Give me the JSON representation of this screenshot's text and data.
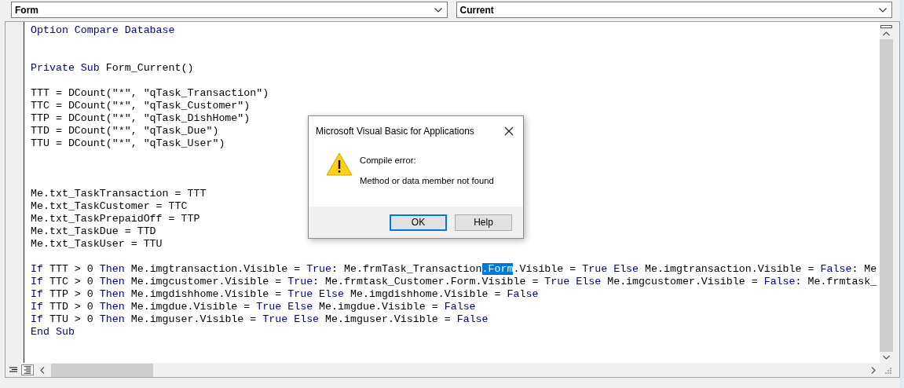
{
  "object_box": {
    "value": "Form"
  },
  "procedure_box": {
    "value": "Current"
  },
  "code_lines": [
    {
      "kind": "code",
      "tokens": [
        {
          "t": "Option Compare Database",
          "kw": true
        }
      ]
    },
    {
      "kind": "blank"
    },
    {
      "kind": "blank"
    },
    {
      "kind": "code",
      "tokens": [
        {
          "t": "Private Sub",
          "kw": true
        },
        {
          "t": " Form_Current()",
          "kw": false
        }
      ]
    },
    {
      "kind": "blank"
    },
    {
      "kind": "code",
      "tokens": [
        {
          "t": "TTT = DCount(\"*\", \"qTask_Transaction\")",
          "kw": false
        }
      ]
    },
    {
      "kind": "code",
      "tokens": [
        {
          "t": "TTC = DCount(\"*\", \"qTask_Customer\")",
          "kw": false
        }
      ]
    },
    {
      "kind": "code",
      "tokens": [
        {
          "t": "TTP = DCount(\"*\", \"qTask_DishHome\")",
          "kw": false
        }
      ]
    },
    {
      "kind": "code",
      "tokens": [
        {
          "t": "TTD = DCount(\"*\", \"qTask_Due\")",
          "kw": false
        }
      ]
    },
    {
      "kind": "code",
      "tokens": [
        {
          "t": "TTU = DCount(\"*\", \"qTask_User\")",
          "kw": false
        }
      ]
    },
    {
      "kind": "blank"
    },
    {
      "kind": "blank"
    },
    {
      "kind": "blank"
    },
    {
      "kind": "code",
      "tokens": [
        {
          "t": "Me.txt_TaskTransaction = TTT",
          "kw": false
        }
      ]
    },
    {
      "kind": "code",
      "tokens": [
        {
          "t": "Me.txt_TaskCustomer = TTC",
          "kw": false
        }
      ]
    },
    {
      "kind": "code",
      "tokens": [
        {
          "t": "Me.txt_TaskPrepaidOff = TTP",
          "kw": false
        }
      ]
    },
    {
      "kind": "code",
      "tokens": [
        {
          "t": "Me.txt_TaskDue = TTD",
          "kw": false
        }
      ]
    },
    {
      "kind": "code",
      "tokens": [
        {
          "t": "Me.txt_TaskUser = TTU",
          "kw": false
        }
      ]
    },
    {
      "kind": "blank"
    },
    {
      "kind": "code",
      "tokens": [
        {
          "t": "If",
          "kw": true,
          "selected": false
        },
        {
          "t": " TTT > 0 ",
          "kw": false,
          "selected": false
        },
        {
          "t": "Then",
          "kw": true,
          "selected": false
        },
        {
          "t": " Me.imgtransaction.Visible = ",
          "kw": false,
          "selected": false
        },
        {
          "t": "True",
          "kw": true,
          "selected": false
        },
        {
          "t": ": Me.frmTask_Transaction",
          "kw": false,
          "selected": false
        },
        {
          "t": ".Form",
          "kw": false,
          "selected": true
        },
        {
          "t": ".Visible = ",
          "kw": false,
          "selected": false
        },
        {
          "t": "True Else",
          "kw": true,
          "selected": false
        },
        {
          "t": " Me.imgtransaction.Visible = ",
          "kw": false,
          "selected": false
        },
        {
          "t": "False",
          "kw": true,
          "selected": false
        },
        {
          "t": ": Me",
          "kw": false,
          "selected": false
        }
      ]
    },
    {
      "kind": "code",
      "tokens": [
        {
          "t": "If",
          "kw": true
        },
        {
          "t": " TTC > 0 ",
          "kw": false
        },
        {
          "t": "Then",
          "kw": true
        },
        {
          "t": " Me.imgcustomer.Visible = ",
          "kw": false
        },
        {
          "t": "True",
          "kw": true
        },
        {
          "t": ": Me.frmtask_Customer.Form.Visible = ",
          "kw": false
        },
        {
          "t": "True Else",
          "kw": true
        },
        {
          "t": " Me.imgcustomer.Visible = ",
          "kw": false
        },
        {
          "t": "False",
          "kw": true
        },
        {
          "t": ": Me.frmtask_",
          "kw": false
        }
      ]
    },
    {
      "kind": "code",
      "tokens": [
        {
          "t": "If",
          "kw": true
        },
        {
          "t": " TTP > 0 ",
          "kw": false
        },
        {
          "t": "Then",
          "kw": true
        },
        {
          "t": " Me.imgdishhome.Visible = ",
          "kw": false
        },
        {
          "t": "True Else",
          "kw": true
        },
        {
          "t": " Me.imgdishhome.Visible = ",
          "kw": false
        },
        {
          "t": "False",
          "kw": true
        }
      ]
    },
    {
      "kind": "code",
      "tokens": [
        {
          "t": "If",
          "kw": true
        },
        {
          "t": " TTD > 0 ",
          "kw": false
        },
        {
          "t": "Then",
          "kw": true
        },
        {
          "t": " Me.imgdue.Visible = ",
          "kw": false
        },
        {
          "t": "True Else",
          "kw": true
        },
        {
          "t": " Me.imgdue.Visible = ",
          "kw": false
        },
        {
          "t": "False",
          "kw": true
        }
      ]
    },
    {
      "kind": "code",
      "tokens": [
        {
          "t": "If",
          "kw": true
        },
        {
          "t": " TTU > 0 ",
          "kw": false
        },
        {
          "t": "Then",
          "kw": true
        },
        {
          "t": " Me.imguser.Visible = ",
          "kw": false
        },
        {
          "t": "True Else",
          "kw": true
        },
        {
          "t": " Me.imguser.Visible = ",
          "kw": false
        },
        {
          "t": "False",
          "kw": true
        }
      ]
    },
    {
      "kind": "code",
      "tokens": [
        {
          "t": "End Sub",
          "kw": true
        }
      ]
    }
  ],
  "dialog": {
    "title": "Microsoft Visual Basic for Applications",
    "heading": "Compile error:",
    "message": "Method or data member not found",
    "buttons": [
      {
        "label": "OK",
        "default": true
      },
      {
        "label": "Help",
        "default": false
      }
    ]
  }
}
